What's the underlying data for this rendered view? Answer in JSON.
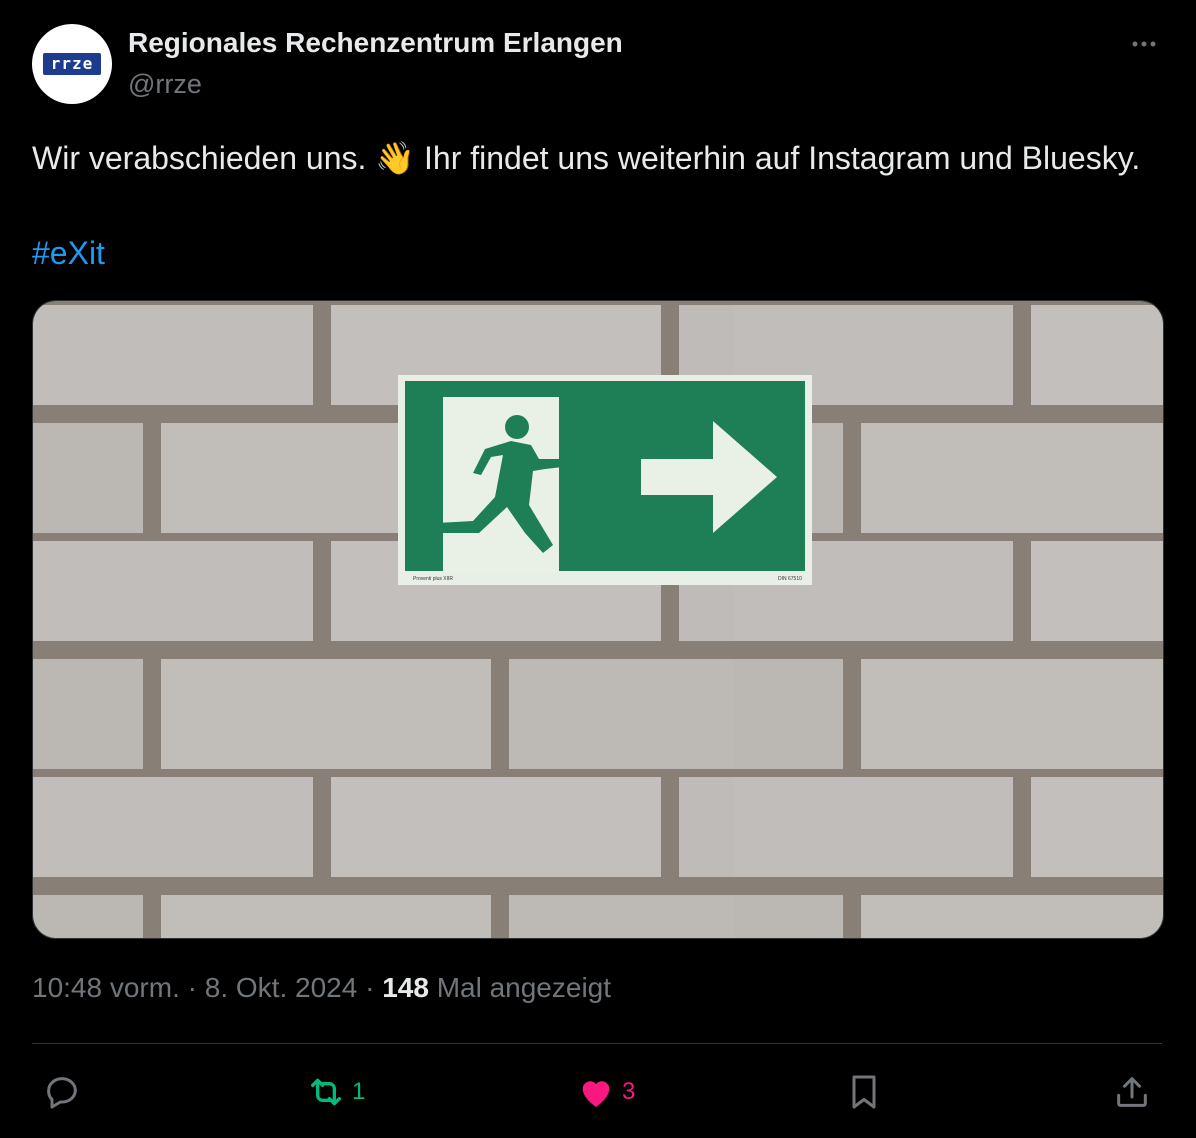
{
  "tweet": {
    "author_name": "Regionales Rechenzentrum Erlangen",
    "author_handle": "@rrze",
    "avatar_logo_text": "rrze",
    "text": "Wir verabschieden uns. 👋 Ihr findet uns weiterhin auf Instagram und Bluesky.",
    "hashtag": "#eXit",
    "media": {
      "description_icon": "emergency-exit-sign",
      "sign_small_text_left": "Proventi plus XIIR",
      "sign_small_text_right": "DIN 67510"
    },
    "time": "10:48 vorm.",
    "separator": "·",
    "date": "8. Okt. 2024",
    "views_count": "148",
    "views_label": "Mal angezeigt"
  },
  "actions": {
    "reply": {
      "icon": "reply-icon",
      "count": ""
    },
    "retweet": {
      "icon": "retweet-icon",
      "count": "1",
      "color": "#00ba7c"
    },
    "like": {
      "icon": "heart-icon",
      "count": "3",
      "color": "#f91880"
    },
    "bookmark": {
      "icon": "bookmark-icon",
      "count": ""
    },
    "share": {
      "icon": "share-icon",
      "count": ""
    }
  },
  "colors": {
    "background": "#000000",
    "text": "#e7e9ea",
    "muted": "#71767b",
    "link": "#1d9bf0",
    "sign_green": "#1e7e55"
  }
}
